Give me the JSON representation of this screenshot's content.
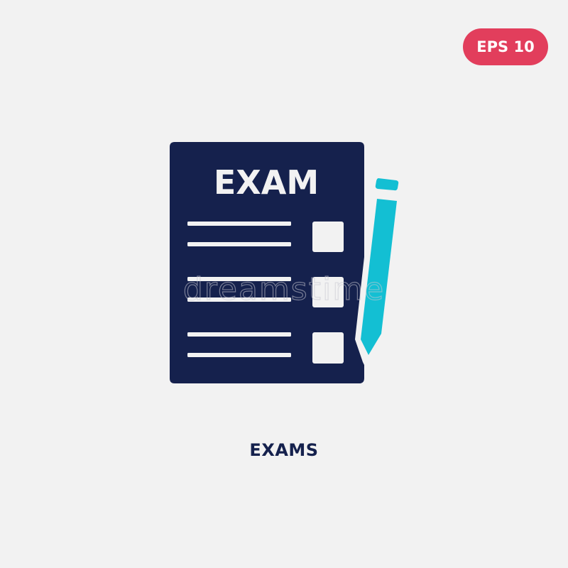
{
  "badge": {
    "label": "EPS 10",
    "color": "#e23e5c"
  },
  "icon": {
    "name": "exam-paper-with-pencil",
    "paper_title": "EXAM",
    "paper_color": "#15214d",
    "pencil_color": "#13bfd3",
    "question_rows": 3
  },
  "caption": {
    "label": "EXAMS",
    "color": "#15214d"
  },
  "watermark": {
    "text": "dreamstime"
  }
}
